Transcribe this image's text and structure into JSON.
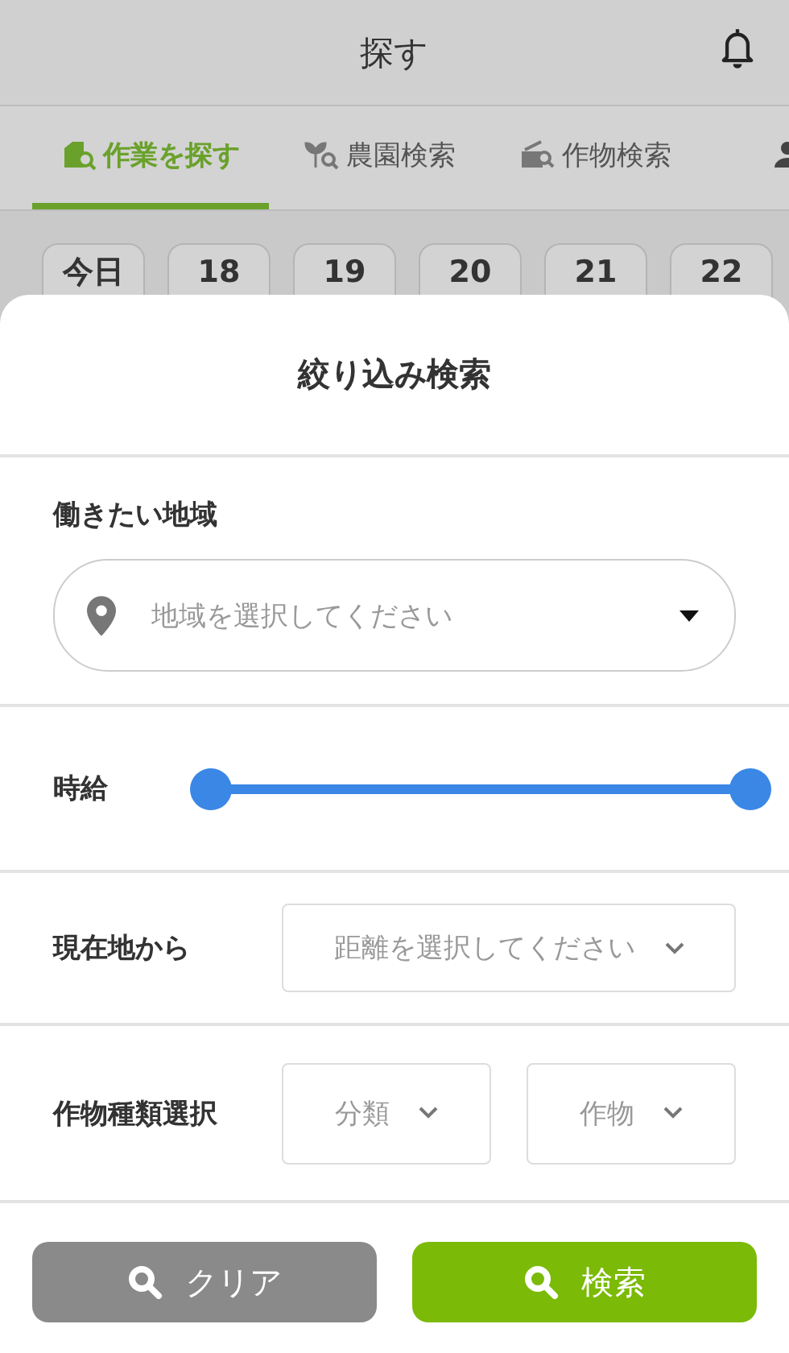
{
  "header": {
    "title": "探す"
  },
  "tabs": [
    {
      "label": "作業を探す",
      "selected": true
    },
    {
      "label": "農園検索",
      "selected": false
    },
    {
      "label": "作物検索",
      "selected": false
    },
    {
      "selected": false
    }
  ],
  "dates": [
    "今日",
    "18",
    "19",
    "20",
    "21",
    "22"
  ],
  "filter_sheet": {
    "title": "絞り込み検索",
    "region": {
      "label": "働きたい地域",
      "placeholder": "地域を選択してください"
    },
    "wage": {
      "label": "時給",
      "thumbs": [
        {
          "level": 0
        },
        {
          "level": 1
        }
      ]
    },
    "distance": {
      "label": "現在地から",
      "placeholder": "距離を選択してください"
    },
    "crop_type": {
      "label": "作物種類選択",
      "selects": [
        "分類",
        "作物"
      ]
    },
    "buttons": [
      {
        "label": "クリア",
        "kind": "clear"
      },
      {
        "label": "検索",
        "kind": "search"
      }
    ]
  }
}
